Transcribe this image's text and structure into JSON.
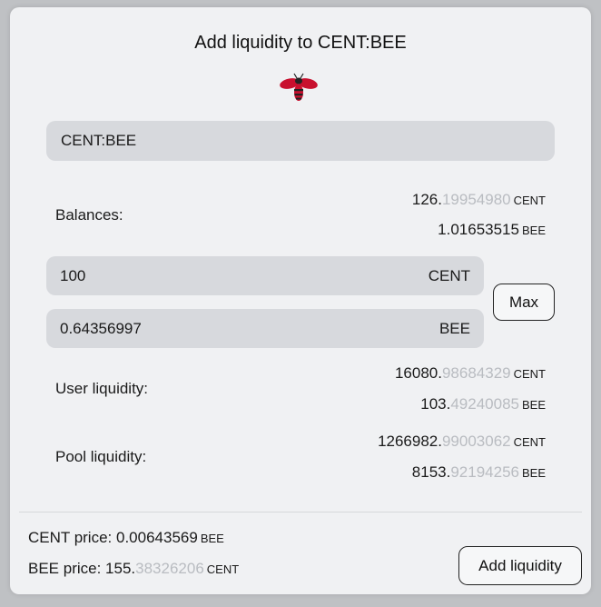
{
  "title": "Add liquidity to CENT:BEE",
  "logo_icon": "bee-icon",
  "pair_value": "CENT:BEE",
  "balances": {
    "label": "Balances:",
    "cent_main": "126.",
    "cent_dim": "19954980",
    "cent_unit": "CENT",
    "bee_main": "1.01653515",
    "bee_dim": "",
    "bee_unit": "BEE"
  },
  "inputs": {
    "cent_value": "100",
    "cent_unit": "CENT",
    "bee_value": "0.64356997",
    "bee_unit": "BEE",
    "max_label": "Max"
  },
  "user_liquidity": {
    "label": "User liquidity:",
    "cent_main": "16080.",
    "cent_dim": "98684329",
    "cent_unit": "CENT",
    "bee_main": "103.",
    "bee_dim": "49240085",
    "bee_unit": "BEE"
  },
  "pool_liquidity": {
    "label": "Pool liquidity:",
    "cent_main": "1266982.",
    "cent_dim": "99003062",
    "cent_unit": "CENT",
    "bee_main": "8153.",
    "bee_dim": "92194256",
    "bee_unit": "BEE"
  },
  "prices": {
    "cent_label": "CENT price: ",
    "cent_main": "0.00643569",
    "cent_dim": "",
    "cent_unit": "BEE",
    "bee_label": "BEE price: ",
    "bee_main": "155.",
    "bee_dim": "38326206",
    "bee_unit": "CENT"
  },
  "add_button_label": "Add liquidity",
  "colors": {
    "card_bg": "#f0f1f3",
    "field_bg": "#d7d9dd",
    "dim_text": "#b9bcc1",
    "bee_red": "#c8102e"
  }
}
